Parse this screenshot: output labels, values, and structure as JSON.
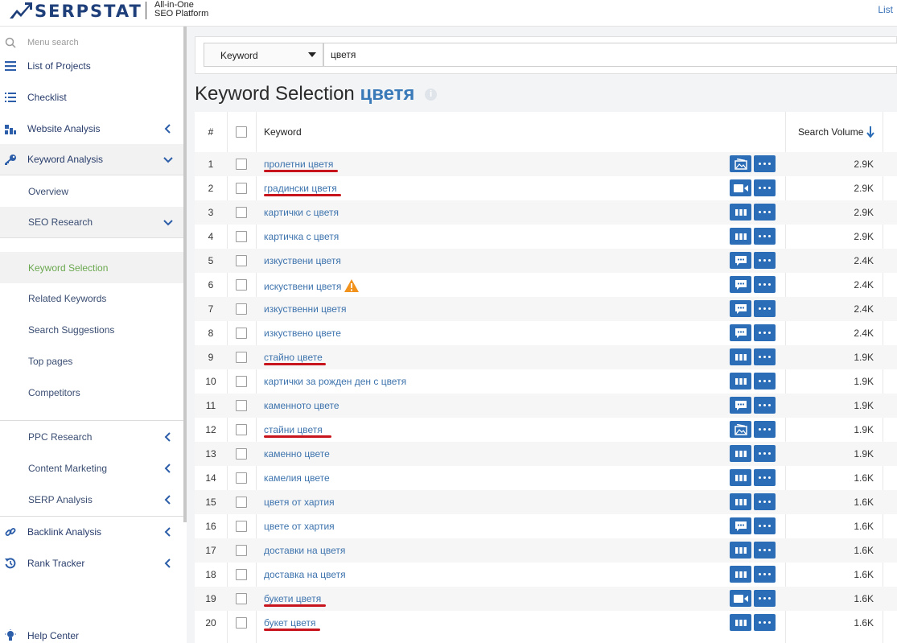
{
  "header": {
    "logo_text": "SERPSTAT",
    "tagline_line1": "All-in-One",
    "tagline_line2": "SEO Platform",
    "right_link": "List"
  },
  "sidebar": {
    "search_placeholder": "Menu search",
    "items": [
      {
        "label": "List of Projects",
        "icon": "list-icon"
      },
      {
        "label": "Checklist",
        "icon": "checklist-icon"
      },
      {
        "label": "Website Analysis",
        "icon": "chart-icon"
      },
      {
        "label": "Keyword Analysis",
        "icon": "key-icon"
      },
      {
        "label": "Overview"
      },
      {
        "label": "SEO Research"
      },
      {
        "label": "Keyword Selection"
      },
      {
        "label": "Related Keywords"
      },
      {
        "label": "Search Suggestions"
      },
      {
        "label": "Top pages"
      },
      {
        "label": "Competitors"
      },
      {
        "label": "PPC Research"
      },
      {
        "label": "Content Marketing"
      },
      {
        "label": "SERP Analysis"
      },
      {
        "label": "Backlink Analysis",
        "icon": "link-icon"
      },
      {
        "label": "Rank Tracker",
        "icon": "history-icon"
      },
      {
        "label": "Help Center",
        "icon": "lightbulb-icon"
      }
    ]
  },
  "search": {
    "type_selected": "Keyword",
    "query": "цветя"
  },
  "title": {
    "prefix": "Keyword Selection",
    "keyword": "цветя"
  },
  "table": {
    "columns": {
      "num": "#",
      "keyword": "Keyword",
      "volume": "Search Volume"
    },
    "accent": "#2b6db6",
    "rows": [
      {
        "n": "1",
        "keyword": "пролетни цветя",
        "volume": "2.9K",
        "serp": "image-icon",
        "underlined": true
      },
      {
        "n": "2",
        "keyword": "градински цветя",
        "volume": "2.9K",
        "serp": "video-icon",
        "underlined": true
      },
      {
        "n": "3",
        "keyword": "картички с цветя",
        "volume": "2.9K",
        "serp": "sitelinks-icon",
        "underlined": false
      },
      {
        "n": "4",
        "keyword": "картичка с цветя",
        "volume": "2.9K",
        "serp": "sitelinks-icon",
        "underlined": false
      },
      {
        "n": "5",
        "keyword": "изкуствени цветя",
        "volume": "2.4K",
        "serp": "comment-icon",
        "underlined": false
      },
      {
        "n": "6",
        "keyword": "искуствени цветя",
        "volume": "2.4K",
        "serp": "comment-icon",
        "underlined": false,
        "warning": true
      },
      {
        "n": "7",
        "keyword": "изкуственни цветя",
        "volume": "2.4K",
        "serp": "comment-icon",
        "underlined": false
      },
      {
        "n": "8",
        "keyword": "изкуствено цвете",
        "volume": "2.4K",
        "serp": "comment-icon",
        "underlined": false
      },
      {
        "n": "9",
        "keyword": "стайно цвете",
        "volume": "1.9K",
        "serp": "sitelinks-icon",
        "underlined": true
      },
      {
        "n": "10",
        "keyword": "картички за рожден ден с цветя",
        "volume": "1.9K",
        "serp": "sitelinks-icon",
        "underlined": false
      },
      {
        "n": "11",
        "keyword": "каменното цвете",
        "volume": "1.9K",
        "serp": "comment-icon",
        "underlined": false
      },
      {
        "n": "12",
        "keyword": "стайни цветя",
        "volume": "1.9K",
        "serp": "image-icon",
        "underlined": true
      },
      {
        "n": "13",
        "keyword": "каменно цвете",
        "volume": "1.9K",
        "serp": "sitelinks-icon",
        "underlined": false
      },
      {
        "n": "14",
        "keyword": "камелия цвете",
        "volume": "1.6K",
        "serp": "sitelinks-icon",
        "underlined": false
      },
      {
        "n": "15",
        "keyword": "цветя от хартия",
        "volume": "1.6K",
        "serp": "sitelinks-icon",
        "underlined": false
      },
      {
        "n": "16",
        "keyword": "цвете от хартия",
        "volume": "1.6K",
        "serp": "comment-icon",
        "underlined": false
      },
      {
        "n": "17",
        "keyword": "доставки на цветя",
        "volume": "1.6K",
        "serp": "sitelinks-icon",
        "underlined": false
      },
      {
        "n": "18",
        "keyword": "доставка на цветя",
        "volume": "1.6K",
        "serp": "sitelinks-icon",
        "underlined": false
      },
      {
        "n": "19",
        "keyword": "букети цветя",
        "volume": "1.6K",
        "serp": "video-icon",
        "underlined": true
      },
      {
        "n": "20",
        "keyword": "букет цветя",
        "volume": "1.6K",
        "serp": "sitelinks-icon",
        "underlined": true
      }
    ]
  }
}
